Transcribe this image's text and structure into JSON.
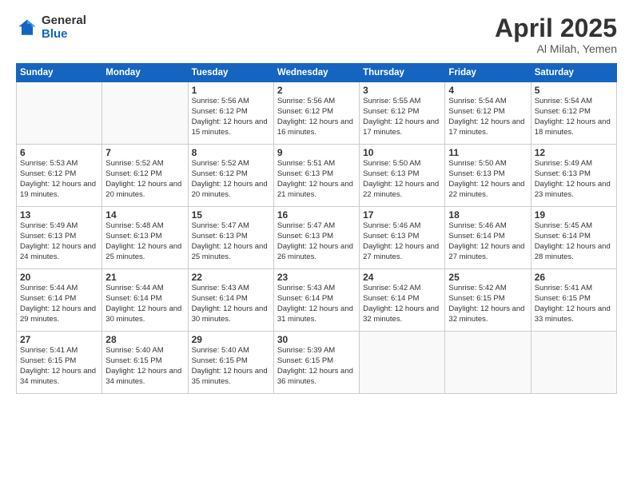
{
  "logo": {
    "general": "General",
    "blue": "Blue"
  },
  "title": {
    "month_year": "April 2025",
    "location": "Al Milah, Yemen"
  },
  "days_of_week": [
    "Sunday",
    "Monday",
    "Tuesday",
    "Wednesday",
    "Thursday",
    "Friday",
    "Saturday"
  ],
  "weeks": [
    [
      {
        "day": "",
        "info": ""
      },
      {
        "day": "",
        "info": ""
      },
      {
        "day": "1",
        "info": "Sunrise: 5:56 AM\nSunset: 6:12 PM\nDaylight: 12 hours and 15 minutes."
      },
      {
        "day": "2",
        "info": "Sunrise: 5:56 AM\nSunset: 6:12 PM\nDaylight: 12 hours and 16 minutes."
      },
      {
        "day": "3",
        "info": "Sunrise: 5:55 AM\nSunset: 6:12 PM\nDaylight: 12 hours and 17 minutes."
      },
      {
        "day": "4",
        "info": "Sunrise: 5:54 AM\nSunset: 6:12 PM\nDaylight: 12 hours and 17 minutes."
      },
      {
        "day": "5",
        "info": "Sunrise: 5:54 AM\nSunset: 6:12 PM\nDaylight: 12 hours and 18 minutes."
      }
    ],
    [
      {
        "day": "6",
        "info": "Sunrise: 5:53 AM\nSunset: 6:12 PM\nDaylight: 12 hours and 19 minutes."
      },
      {
        "day": "7",
        "info": "Sunrise: 5:52 AM\nSunset: 6:12 PM\nDaylight: 12 hours and 20 minutes."
      },
      {
        "day": "8",
        "info": "Sunrise: 5:52 AM\nSunset: 6:12 PM\nDaylight: 12 hours and 20 minutes."
      },
      {
        "day": "9",
        "info": "Sunrise: 5:51 AM\nSunset: 6:13 PM\nDaylight: 12 hours and 21 minutes."
      },
      {
        "day": "10",
        "info": "Sunrise: 5:50 AM\nSunset: 6:13 PM\nDaylight: 12 hours and 22 minutes."
      },
      {
        "day": "11",
        "info": "Sunrise: 5:50 AM\nSunset: 6:13 PM\nDaylight: 12 hours and 22 minutes."
      },
      {
        "day": "12",
        "info": "Sunrise: 5:49 AM\nSunset: 6:13 PM\nDaylight: 12 hours and 23 minutes."
      }
    ],
    [
      {
        "day": "13",
        "info": "Sunrise: 5:49 AM\nSunset: 6:13 PM\nDaylight: 12 hours and 24 minutes."
      },
      {
        "day": "14",
        "info": "Sunrise: 5:48 AM\nSunset: 6:13 PM\nDaylight: 12 hours and 25 minutes."
      },
      {
        "day": "15",
        "info": "Sunrise: 5:47 AM\nSunset: 6:13 PM\nDaylight: 12 hours and 25 minutes."
      },
      {
        "day": "16",
        "info": "Sunrise: 5:47 AM\nSunset: 6:13 PM\nDaylight: 12 hours and 26 minutes."
      },
      {
        "day": "17",
        "info": "Sunrise: 5:46 AM\nSunset: 6:13 PM\nDaylight: 12 hours and 27 minutes."
      },
      {
        "day": "18",
        "info": "Sunrise: 5:46 AM\nSunset: 6:14 PM\nDaylight: 12 hours and 27 minutes."
      },
      {
        "day": "19",
        "info": "Sunrise: 5:45 AM\nSunset: 6:14 PM\nDaylight: 12 hours and 28 minutes."
      }
    ],
    [
      {
        "day": "20",
        "info": "Sunrise: 5:44 AM\nSunset: 6:14 PM\nDaylight: 12 hours and 29 minutes."
      },
      {
        "day": "21",
        "info": "Sunrise: 5:44 AM\nSunset: 6:14 PM\nDaylight: 12 hours and 30 minutes."
      },
      {
        "day": "22",
        "info": "Sunrise: 5:43 AM\nSunset: 6:14 PM\nDaylight: 12 hours and 30 minutes."
      },
      {
        "day": "23",
        "info": "Sunrise: 5:43 AM\nSunset: 6:14 PM\nDaylight: 12 hours and 31 minutes."
      },
      {
        "day": "24",
        "info": "Sunrise: 5:42 AM\nSunset: 6:14 PM\nDaylight: 12 hours and 32 minutes."
      },
      {
        "day": "25",
        "info": "Sunrise: 5:42 AM\nSunset: 6:15 PM\nDaylight: 12 hours and 32 minutes."
      },
      {
        "day": "26",
        "info": "Sunrise: 5:41 AM\nSunset: 6:15 PM\nDaylight: 12 hours and 33 minutes."
      }
    ],
    [
      {
        "day": "27",
        "info": "Sunrise: 5:41 AM\nSunset: 6:15 PM\nDaylight: 12 hours and 34 minutes."
      },
      {
        "day": "28",
        "info": "Sunrise: 5:40 AM\nSunset: 6:15 PM\nDaylight: 12 hours and 34 minutes."
      },
      {
        "day": "29",
        "info": "Sunrise: 5:40 AM\nSunset: 6:15 PM\nDaylight: 12 hours and 35 minutes."
      },
      {
        "day": "30",
        "info": "Sunrise: 5:39 AM\nSunset: 6:15 PM\nDaylight: 12 hours and 36 minutes."
      },
      {
        "day": "",
        "info": ""
      },
      {
        "day": "",
        "info": ""
      },
      {
        "day": "",
        "info": ""
      }
    ]
  ]
}
